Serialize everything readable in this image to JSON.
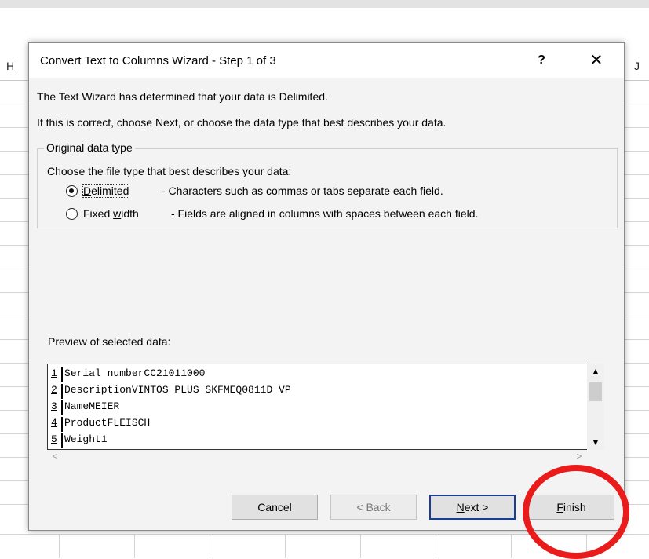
{
  "sheet": {
    "col_left": "H",
    "col_right": "J"
  },
  "dialog": {
    "title": "Convert Text to Columns Wizard - Step 1 of 3",
    "help_label": "?",
    "close_label": "✕",
    "intro_line1": "The Text Wizard has determined that your data is Delimited.",
    "intro_line2": "If this is correct, choose Next, or choose the data type that best describes your data.",
    "group_title": "Original data type",
    "choose_text": "Choose the file type that best describes your data:",
    "options": [
      {
        "label_pre": "",
        "label_accel": "D",
        "label_post": "elimited",
        "description": "- Characters such as commas or tabs separate each field.",
        "checked": true
      },
      {
        "label_pre": "Fixed ",
        "label_accel": "w",
        "label_post": "idth",
        "description": "- Fields are aligned in columns with spaces between each field.",
        "checked": false
      }
    ],
    "preview_label": "Preview of selected data:",
    "preview_rows": [
      {
        "num": "1",
        "text": "Serial numberCC21011000"
      },
      {
        "num": "2",
        "text": "DescriptionVINTOS PLUS SKFMEQ0811D VP"
      },
      {
        "num": "3",
        "text": "NameMEIER"
      },
      {
        "num": "4",
        "text": "ProductFLEISCH"
      },
      {
        "num": "5",
        "text": "Weight1"
      }
    ],
    "scroll": {
      "up": "▲",
      "down": "▼",
      "left": "<",
      "right": ">"
    },
    "buttons": {
      "cancel": "Cancel",
      "back": "< Back",
      "next_accel": "N",
      "next_rest": "ext >",
      "finish_accel": "F",
      "finish_rest": "inish"
    }
  },
  "annotation": {
    "color": "#ea1b1b"
  }
}
